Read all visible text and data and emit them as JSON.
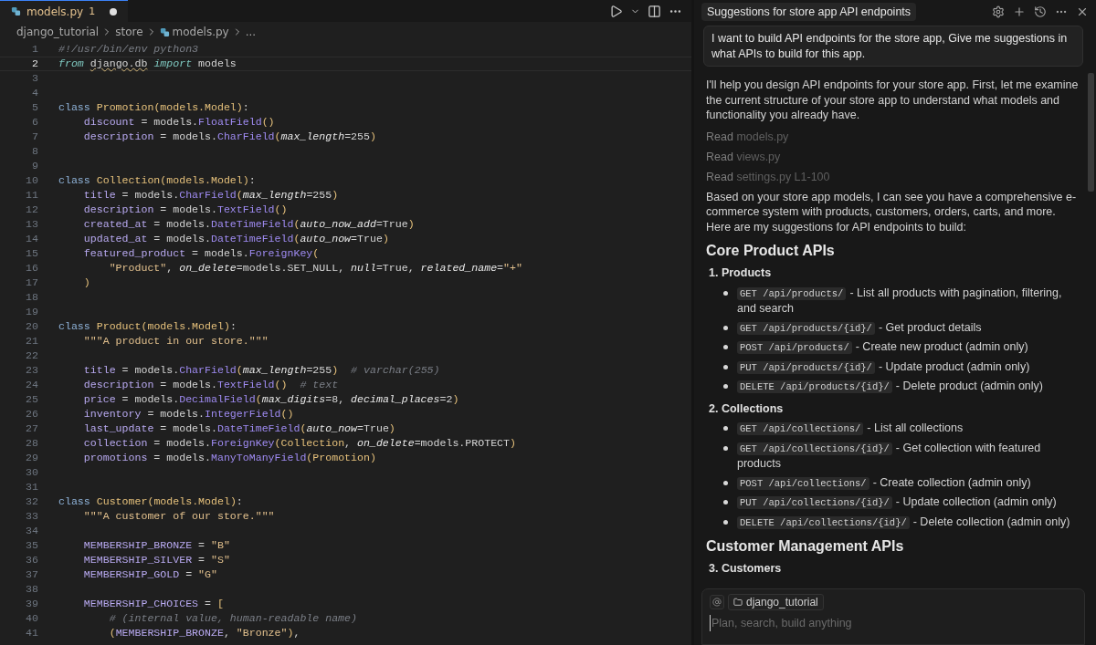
{
  "editor": {
    "tab": {
      "file": "models.py",
      "problems": "1",
      "modified": true
    },
    "breadcrumbs": [
      "django_tutorial",
      "store",
      "models.py",
      "..."
    ],
    "lines": [
      {
        "number": "1",
        "current": false,
        "tokens": [
          {
            "kind": "cm",
            "text": "#!/usr/bin/env python3"
          }
        ]
      },
      {
        "number": "2",
        "current": true,
        "tokens": [
          {
            "kind": "kwi",
            "text": "from "
          },
          {
            "kind": "warn",
            "text": "django.db"
          },
          {
            "kind": "kwi",
            "text": " import"
          },
          {
            "kind": "p",
            "text": " models"
          }
        ]
      },
      {
        "number": "3",
        "current": false
      },
      {
        "number": "4",
        "current": false
      },
      {
        "number": "5",
        "current": false,
        "tokens": [
          {
            "kind": "kw",
            "text": "class "
          },
          {
            "kind": "cls",
            "text": "Promotion"
          },
          {
            "kind": "punc",
            "text": "("
          },
          {
            "kind": "cls",
            "text": "models.Model"
          },
          {
            "kind": "punc",
            "text": ")"
          },
          {
            "kind": "p",
            "text": ":"
          }
        ]
      },
      {
        "number": "6",
        "current": false,
        "tokens": [
          {
            "kind": "var",
            "text": "    discount"
          },
          {
            "kind": "p",
            "text": " = models."
          },
          {
            "kind": "fn",
            "text": "FloatField"
          },
          {
            "kind": "punc",
            "text": "()"
          }
        ]
      },
      {
        "number": "7",
        "current": false,
        "tokens": [
          {
            "kind": "var",
            "text": "    description"
          },
          {
            "kind": "p",
            "text": " = models."
          },
          {
            "kind": "fn",
            "text": "CharField"
          },
          {
            "kind": "punc",
            "text": "("
          },
          {
            "kind": "param",
            "text": "max_length"
          },
          {
            "kind": "p",
            "text": "=255"
          },
          {
            "kind": "punc",
            "text": ")"
          }
        ]
      },
      {
        "number": "8",
        "current": false
      },
      {
        "number": "9",
        "current": false
      },
      {
        "number": "10",
        "current": false,
        "tokens": [
          {
            "kind": "kw",
            "text": "class "
          },
          {
            "kind": "cls",
            "text": "Collection"
          },
          {
            "kind": "punc",
            "text": "("
          },
          {
            "kind": "cls",
            "text": "models.Model"
          },
          {
            "kind": "punc",
            "text": ")"
          },
          {
            "kind": "p",
            "text": ":"
          }
        ]
      },
      {
        "number": "11",
        "current": false,
        "tokens": [
          {
            "kind": "var",
            "text": "    title"
          },
          {
            "kind": "p",
            "text": " = models."
          },
          {
            "kind": "fn",
            "text": "CharField"
          },
          {
            "kind": "punc",
            "text": "("
          },
          {
            "kind": "param",
            "text": "max_length"
          },
          {
            "kind": "p",
            "text": "=255"
          },
          {
            "kind": "punc",
            "text": ")"
          }
        ]
      },
      {
        "number": "12",
        "current": false,
        "tokens": [
          {
            "kind": "var",
            "text": "    description"
          },
          {
            "kind": "p",
            "text": " = models."
          },
          {
            "kind": "fn",
            "text": "TextField"
          },
          {
            "kind": "punc",
            "text": "()"
          }
        ]
      },
      {
        "number": "13",
        "current": false,
        "tokens": [
          {
            "kind": "var",
            "text": "    created_at"
          },
          {
            "kind": "p",
            "text": " = models."
          },
          {
            "kind": "fn",
            "text": "DateTimeField"
          },
          {
            "kind": "punc",
            "text": "("
          },
          {
            "kind": "param",
            "text": "auto_now_add"
          },
          {
            "kind": "p",
            "text": "=True"
          },
          {
            "kind": "punc",
            "text": ")"
          }
        ]
      },
      {
        "number": "14",
        "current": false,
        "tokens": [
          {
            "kind": "var",
            "text": "    updated_at"
          },
          {
            "kind": "p",
            "text": " = models."
          },
          {
            "kind": "fn",
            "text": "DateTimeField"
          },
          {
            "kind": "punc",
            "text": "("
          },
          {
            "kind": "param",
            "text": "auto_now"
          },
          {
            "kind": "p",
            "text": "=True"
          },
          {
            "kind": "punc",
            "text": ")"
          }
        ]
      },
      {
        "number": "15",
        "current": false,
        "tokens": [
          {
            "kind": "var",
            "text": "    featured_product"
          },
          {
            "kind": "p",
            "text": " = models."
          },
          {
            "kind": "fn",
            "text": "ForeignKey"
          },
          {
            "kind": "punc",
            "text": "("
          }
        ]
      },
      {
        "number": "16",
        "current": false,
        "tokens": [
          {
            "kind": "str",
            "text": "        \"Product\""
          },
          {
            "kind": "p",
            "text": ", "
          },
          {
            "kind": "param",
            "text": "on_delete"
          },
          {
            "kind": "p",
            "text": "=models.SET_NULL, "
          },
          {
            "kind": "param",
            "text": "null"
          },
          {
            "kind": "p",
            "text": "=True, "
          },
          {
            "kind": "param",
            "text": "related_name"
          },
          {
            "kind": "p",
            "text": "="
          },
          {
            "kind": "str",
            "text": "\"+\""
          }
        ]
      },
      {
        "number": "17",
        "current": false,
        "tokens": [
          {
            "kind": "punc",
            "text": "    )"
          }
        ]
      },
      {
        "number": "18",
        "current": false
      },
      {
        "number": "19",
        "current": false
      },
      {
        "number": "20",
        "current": false,
        "tokens": [
          {
            "kind": "kw",
            "text": "class "
          },
          {
            "kind": "cls",
            "text": "Product"
          },
          {
            "kind": "punc",
            "text": "("
          },
          {
            "kind": "cls",
            "text": "models.Model"
          },
          {
            "kind": "punc",
            "text": ")"
          },
          {
            "kind": "p",
            "text": ":"
          }
        ]
      },
      {
        "number": "21",
        "current": false,
        "tokens": [
          {
            "kind": "str",
            "text": "    \"\"\"A product in our store.\"\"\""
          }
        ]
      },
      {
        "number": "22",
        "current": false
      },
      {
        "number": "23",
        "current": false,
        "tokens": [
          {
            "kind": "var",
            "text": "    title"
          },
          {
            "kind": "p",
            "text": " = models."
          },
          {
            "kind": "fn",
            "text": "CharField"
          },
          {
            "kind": "punc",
            "text": "("
          },
          {
            "kind": "param",
            "text": "max_length"
          },
          {
            "kind": "p",
            "text": "=255"
          },
          {
            "kind": "punc",
            "text": ")"
          },
          {
            "kind": "cm",
            "text": "  # varchar(255)"
          }
        ]
      },
      {
        "number": "24",
        "current": false,
        "tokens": [
          {
            "kind": "var",
            "text": "    description"
          },
          {
            "kind": "p",
            "text": " = models."
          },
          {
            "kind": "fn",
            "text": "TextField"
          },
          {
            "kind": "punc",
            "text": "()"
          },
          {
            "kind": "cm",
            "text": "  # text"
          }
        ]
      },
      {
        "number": "25",
        "current": false,
        "tokens": [
          {
            "kind": "var",
            "text": "    price"
          },
          {
            "kind": "p",
            "text": " = models."
          },
          {
            "kind": "fn",
            "text": "DecimalField"
          },
          {
            "kind": "punc",
            "text": "("
          },
          {
            "kind": "param",
            "text": "max_digits"
          },
          {
            "kind": "p",
            "text": "=8, "
          },
          {
            "kind": "param",
            "text": "decimal_places"
          },
          {
            "kind": "p",
            "text": "=2"
          },
          {
            "kind": "punc",
            "text": ")"
          }
        ]
      },
      {
        "number": "26",
        "current": false,
        "tokens": [
          {
            "kind": "var",
            "text": "    inventory"
          },
          {
            "kind": "p",
            "text": " = models."
          },
          {
            "kind": "fn",
            "text": "IntegerField"
          },
          {
            "kind": "punc",
            "text": "()"
          }
        ]
      },
      {
        "number": "27",
        "current": false,
        "tokens": [
          {
            "kind": "var",
            "text": "    last_update"
          },
          {
            "kind": "p",
            "text": " = models."
          },
          {
            "kind": "fn",
            "text": "DateTimeField"
          },
          {
            "kind": "punc",
            "text": "("
          },
          {
            "kind": "param",
            "text": "auto_now"
          },
          {
            "kind": "p",
            "text": "=True"
          },
          {
            "kind": "punc",
            "text": ")"
          }
        ]
      },
      {
        "number": "28",
        "current": false,
        "tokens": [
          {
            "kind": "var",
            "text": "    collection"
          },
          {
            "kind": "p",
            "text": " = models."
          },
          {
            "kind": "fn",
            "text": "ForeignKey"
          },
          {
            "kind": "punc",
            "text": "("
          },
          {
            "kind": "cls",
            "text": "Collection"
          },
          {
            "kind": "p",
            "text": ", "
          },
          {
            "kind": "param",
            "text": "on_delete"
          },
          {
            "kind": "p",
            "text": "=models.PROTECT"
          },
          {
            "kind": "punc",
            "text": ")"
          }
        ]
      },
      {
        "number": "29",
        "current": false,
        "tokens": [
          {
            "kind": "var",
            "text": "    promotions"
          },
          {
            "kind": "p",
            "text": " = models."
          },
          {
            "kind": "fn",
            "text": "ManyToManyField"
          },
          {
            "kind": "punc",
            "text": "("
          },
          {
            "kind": "cls",
            "text": "Promotion"
          },
          {
            "kind": "punc",
            "text": ")"
          }
        ]
      },
      {
        "number": "30",
        "current": false
      },
      {
        "number": "31",
        "current": false
      },
      {
        "number": "32",
        "current": false,
        "tokens": [
          {
            "kind": "kw",
            "text": "class "
          },
          {
            "kind": "cls",
            "text": "Customer"
          },
          {
            "kind": "punc",
            "text": "("
          },
          {
            "kind": "cls",
            "text": "models.Model"
          },
          {
            "kind": "punc",
            "text": ")"
          },
          {
            "kind": "p",
            "text": ":"
          }
        ]
      },
      {
        "number": "33",
        "current": false,
        "tokens": [
          {
            "kind": "str",
            "text": "    \"\"\"A customer of our store.\"\"\""
          }
        ]
      },
      {
        "number": "34",
        "current": false
      },
      {
        "number": "35",
        "current": false,
        "tokens": [
          {
            "kind": "var",
            "text": "    MEMBERSHIP_BRONZE"
          },
          {
            "kind": "p",
            "text": " = "
          },
          {
            "kind": "str",
            "text": "\"B\""
          }
        ]
      },
      {
        "number": "36",
        "current": false,
        "tokens": [
          {
            "kind": "var",
            "text": "    MEMBERSHIP_SILVER"
          },
          {
            "kind": "p",
            "text": " = "
          },
          {
            "kind": "str",
            "text": "\"S\""
          }
        ]
      },
      {
        "number": "37",
        "current": false,
        "tokens": [
          {
            "kind": "var",
            "text": "    MEMBERSHIP_GOLD"
          },
          {
            "kind": "p",
            "text": " = "
          },
          {
            "kind": "str",
            "text": "\"G\""
          }
        ]
      },
      {
        "number": "38",
        "current": false
      },
      {
        "number": "39",
        "current": false,
        "tokens": [
          {
            "kind": "var",
            "text": "    MEMBERSHIP_CHOICES"
          },
          {
            "kind": "p",
            "text": " = "
          },
          {
            "kind": "punc",
            "text": "["
          }
        ]
      },
      {
        "number": "40",
        "current": false,
        "tokens": [
          {
            "kind": "cm",
            "text": "        # (internal value, human-readable name)"
          }
        ]
      },
      {
        "number": "41",
        "current": false,
        "tokens": [
          {
            "kind": "punc",
            "text": "        ("
          },
          {
            "kind": "var",
            "text": "MEMBERSHIP_BRONZE"
          },
          {
            "kind": "p",
            "text": ", "
          },
          {
            "kind": "str",
            "text": "\"Bronze\""
          },
          {
            "kind": "punc",
            "text": ")"
          },
          {
            "kind": "p",
            "text": ","
          }
        ]
      }
    ]
  },
  "chat": {
    "title": "Suggestions for store app API endpoints",
    "user_message": "I want to build API endpoints for the store app, Give me suggestions in what APIs to build for this app.",
    "blocks": [
      {
        "kind": "paragraph",
        "text": "I'll help you design API endpoints for your store app. First, let me examine the current structure of your store app to understand what models and functionality you already have."
      },
      {
        "kind": "read",
        "label": "Read",
        "file": "models.py"
      },
      {
        "kind": "read",
        "label": "Read",
        "file": "views.py"
      },
      {
        "kind": "read",
        "label": "Read",
        "file": "settings.py L1-100"
      },
      {
        "kind": "paragraph",
        "text": "Based on your store app models, I can see you have a comprehensive e-commerce system with products, customers, orders, carts, and more. Here are my suggestions for API endpoints to build:"
      },
      {
        "kind": "heading",
        "text": "Core Product APIs"
      },
      {
        "kind": "section",
        "number": "1.",
        "title": "Products",
        "items": [
          {
            "code": "GET /api/products/",
            "desc": "- List all products with pagination, filtering, and search"
          },
          {
            "code": "GET /api/products/{id}/",
            "desc": "- Get product details"
          },
          {
            "code": "POST /api/products/",
            "desc": "- Create new product (admin only)"
          },
          {
            "code": "PUT /api/products/{id}/",
            "desc": "- Update product (admin only)"
          },
          {
            "code": "DELETE /api/products/{id}/",
            "desc": "- Delete product (admin only)"
          }
        ]
      },
      {
        "kind": "section",
        "number": "2.",
        "title": "Collections",
        "items": [
          {
            "code": "GET /api/collections/",
            "desc": "- List all collections"
          },
          {
            "code": "GET /api/collections/{id}/",
            "desc": "- Get collection with featured products"
          },
          {
            "code": "POST /api/collections/",
            "desc": "- Create collection (admin only)"
          },
          {
            "code": "PUT /api/collections/{id}/",
            "desc": "- Update collection (admin only)"
          },
          {
            "code": "DELETE /api/collections/{id}/",
            "desc": "- Delete collection (admin only)"
          }
        ]
      },
      {
        "kind": "heading",
        "text": "Customer Management APIs"
      },
      {
        "kind": "section",
        "number": "3.",
        "title": "Customers"
      }
    ]
  },
  "composer": {
    "context": "django_tutorial",
    "placeholder": "Plan, search, build anything"
  }
}
